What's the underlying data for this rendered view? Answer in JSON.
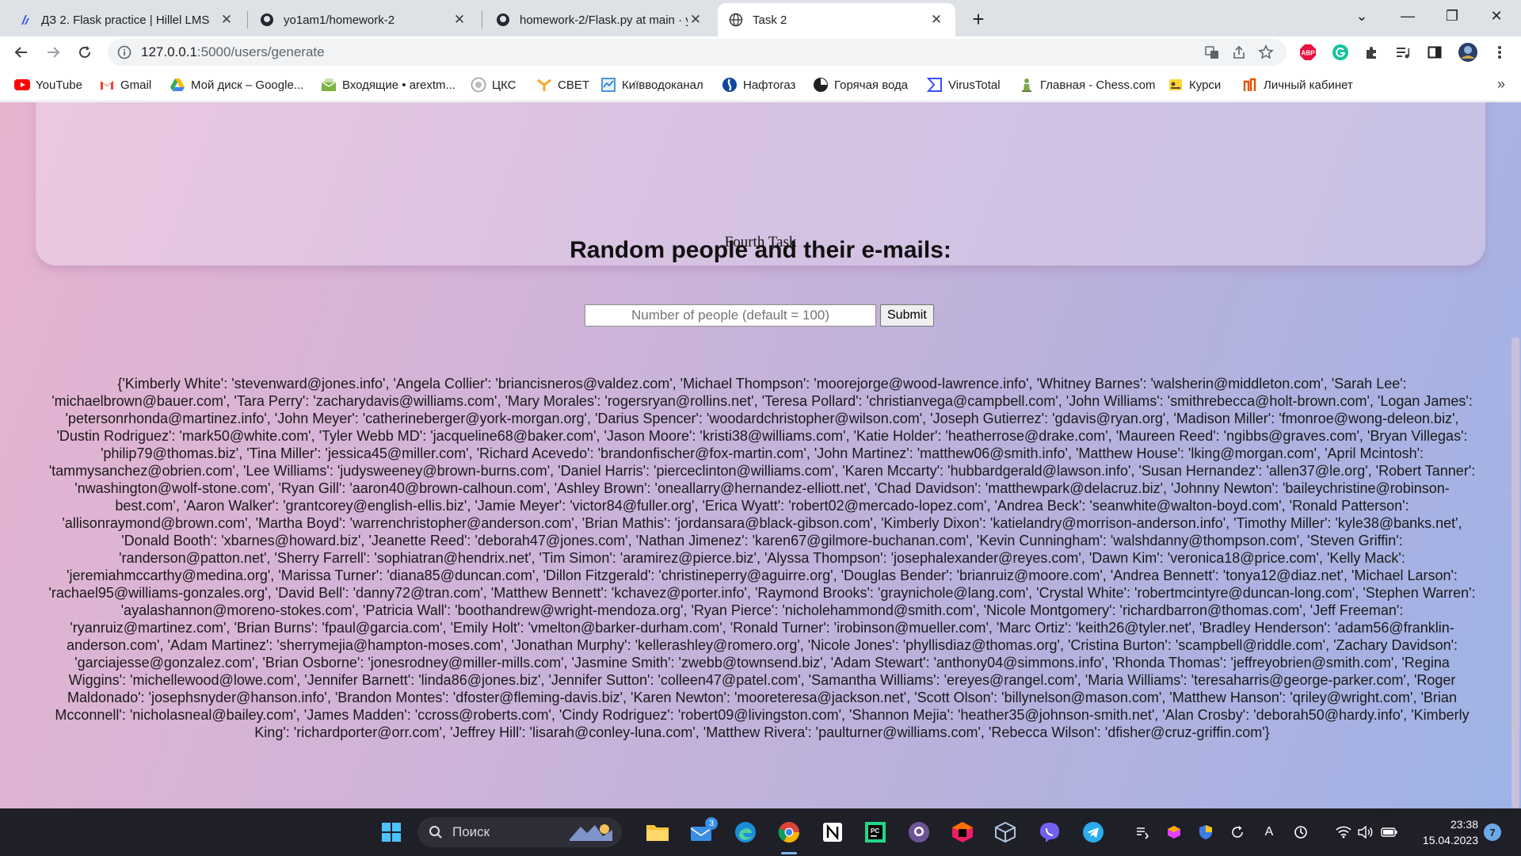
{
  "browser": {
    "tabs": [
      {
        "title": "ДЗ 2. Flask practice | Hillel LMS",
        "icon": "hillel-icon"
      },
      {
        "title": "yo1am1/homework-2",
        "icon": "github-icon"
      },
      {
        "title": "homework-2/Flask.py at main · yo",
        "icon": "github-icon"
      },
      {
        "title": "Task 2",
        "icon": "globe-icon"
      }
    ],
    "address": {
      "host": "127.0.0.1",
      "path": ":5000/users/generate"
    },
    "bookmarks": [
      {
        "label": "YouTube",
        "icon": "youtube-icon"
      },
      {
        "label": "Gmail",
        "icon": "gmail-icon"
      },
      {
        "label": "Мой диск – Google...",
        "icon": "google-drive-icon"
      },
      {
        "label": "Входящие • arextm...",
        "icon": "mail-icon"
      },
      {
        "label": "ЦКС",
        "icon": "cks-icon"
      },
      {
        "label": "СВЕТ",
        "icon": "svet-icon"
      },
      {
        "label": "Київводоканал",
        "icon": "vodokanal-icon"
      },
      {
        "label": "Нафтогаз",
        "icon": "naftogaz-icon"
      },
      {
        "label": "Горячая вода",
        "icon": "hot-water-icon"
      },
      {
        "label": "VirusTotal",
        "icon": "virustotal-icon"
      },
      {
        "label": "Главная - Chess.com",
        "icon": "chess-icon"
      },
      {
        "label": "Курси",
        "icon": "courses-icon"
      },
      {
        "label": "Личный кабинет",
        "icon": "cabinet-icon"
      }
    ],
    "extensions": {
      "abp": "ABP"
    }
  },
  "page": {
    "nav_link": "Fourth Task",
    "heading": "Random people and their e-mails:",
    "input_placeholder": "Number of people (default = 100)",
    "submit_label": "Submit",
    "result": "{'Kimberly White': 'stevenward@jones.info', 'Angela Collier': 'briancisneros@valdez.com', 'Michael Thompson': 'moorejorge@wood-lawrence.info', 'Whitney Barnes': 'walsherin@middleton.com', 'Sarah Lee': 'michaelbrown@bauer.com', 'Tara Perry': 'zacharydavis@williams.com', 'Mary Morales': 'rogersryan@rollins.net', 'Teresa Pollard': 'christianvega@campbell.com', 'John Williams': 'smithrebecca@holt-brown.com', 'Logan James': 'petersonrhonda@martinez.info', 'John Meyer': 'catherineberger@york-morgan.org', 'Darius Spencer': 'woodardchristopher@wilson.com', 'Joseph Gutierrez': 'gdavis@ryan.org', 'Madison Miller': 'fmonroe@wong-deleon.biz', 'Dustin Rodriguez': 'mark50@white.com', 'Tyler Webb MD': 'jacqueline68@baker.com', 'Jason Moore': 'kristi38@williams.com', 'Katie Holder': 'heatherrose@drake.com', 'Maureen Reed': 'ngibbs@graves.com', 'Bryan Villegas': 'philip79@thomas.biz', 'Tina Miller': 'jessica45@miller.com', 'Richard Acevedo': 'brandonfischer@fox-martin.com', 'John Martinez': 'matthew06@smith.info', 'Matthew House': 'lking@morgan.com', 'April Mcintosh': 'tammysanchez@obrien.com', 'Lee Williams': 'judysweeney@brown-burns.com', 'Daniel Harris': 'pierceclinton@williams.com', 'Karen Mccarty': 'hubbardgerald@lawson.info', 'Susan Hernandez': 'allen37@le.org', 'Robert Tanner': 'nwashington@wolf-stone.com', 'Ryan Gill': 'aaron40@brown-calhoun.com', 'Ashley Brown': 'oneallarry@hernandez-elliott.net', 'Chad Davidson': 'matthewpark@delacruz.biz', 'Johnny Newton': 'baileychristine@robinson-best.com', 'Aaron Walker': 'grantcorey@english-ellis.biz', 'Jamie Meyer': 'victor84@fuller.org', 'Erica Wyatt': 'robert02@mercado-lopez.com', 'Andrea Beck': 'seanwhite@walton-boyd.com', 'Ronald Patterson': 'allisonraymond@brown.com', 'Martha Boyd': 'warrenchristopher@anderson.com', 'Brian Mathis': 'jordansara@black-gibson.com', 'Kimberly Dixon': 'katielandry@morrison-anderson.info', 'Timothy Miller': 'kyle38@banks.net', 'Donald Booth': 'xbarnes@howard.biz', 'Jeanette Reed': 'deborah47@jones.com', 'Nathan Jimenez': 'karen67@gilmore-buchanan.com', 'Kevin Cunningham': 'walshdanny@thompson.com', 'Steven Griffin': 'randerson@patton.net', 'Sherry Farrell': 'sophiatran@hendrix.net', 'Tim Simon': 'aramirez@pierce.biz', 'Alyssa Thompson': 'josephalexander@reyes.com', 'Dawn Kim': 'veronica18@price.com', 'Kelly Mack': 'jeremiahmccarthy@medina.org', 'Marissa Turner': 'diana85@duncan.com', 'Dillon Fitzgerald': 'christineperry@aguirre.org', 'Douglas Bender': 'brianruiz@moore.com', 'Andrea Bennett': 'tonya12@diaz.net', 'Michael Larson': 'rachael95@williams-gonzales.org', 'David Bell': 'danny72@tran.com', 'Matthew Bennett': 'kchavez@porter.info', 'Raymond Brooks': 'graynichole@lang.com', 'Crystal White': 'robertmcintyre@duncan-long.com', 'Stephen Warren': 'ayalashannon@moreno-stokes.com', 'Patricia Wall': 'boothandrew@wright-mendoza.org', 'Ryan Pierce': 'nicholehammond@smith.com', 'Nicole Montgomery': 'richardbarron@thomas.com', 'Jeff Freeman': 'ryanruiz@martinez.com', 'Brian Burns': 'fpaul@garcia.com', 'Emily Holt': 'vmelton@barker-durham.com', 'Ronald Turner': 'irobinson@mueller.com', 'Marc Ortiz': 'keith26@tyler.net', 'Bradley Henderson': 'adam56@franklin-anderson.com', 'Adam Martinez': 'sherrymejia@hampton-moses.com', 'Jonathan Murphy': 'kellerashley@romero.org', 'Nicole Jones': 'phyllisdiaz@thomas.org', 'Cristina Burton': 'scampbell@riddle.com', 'Zachary Davidson': 'garciajesse@gonzalez.com', 'Brian Osborne': 'jonesrodney@miller-mills.com', 'Jasmine Smith': 'zwebb@townsend.biz', 'Adam Stewart': 'anthony04@simmons.info', 'Rhonda Thomas': 'jeffreyobrien@smith.com', 'Regina Wiggins': 'michellewood@lowe.com', 'Jennifer Barnett': 'linda86@jones.biz', 'Jennifer Sutton': 'colleen47@patel.com', 'Samantha Williams': 'ereyes@rangel.com', 'Maria Williams': 'teresaharris@george-parker.com', 'Roger Maldonado': 'josephsnyder@hanson.info', 'Brandon Montes': 'dfoster@fleming-davis.biz', 'Karen Newton': 'mooreteresa@jackson.net', 'Scott Olson': 'billynelson@mason.com', 'Matthew Hanson': 'qriley@wright.com', 'Brian Mcconnell': 'nicholasneal@bailey.com', 'James Madden': 'ccross@roberts.com', 'Cindy Rodriguez': 'robert09@livingston.com', 'Shannon Mejia': 'heather35@johnson-smith.net', 'Alan Crosby': 'deborah50@hardy.info', 'Kimberly King': 'richardporter@orr.com', 'Jeffrey Hill': 'lisarah@conley-luna.com', 'Matthew Rivera': 'paulturner@williams.com', 'Rebecca Wilson': 'dfisher@cruz-griffin.com'}"
  },
  "taskbar": {
    "search_label": "Поиск",
    "mail_badge": "3",
    "time": "23:38",
    "date": "15.04.2023",
    "notification_count": "7",
    "lang_indicator": "A"
  },
  "colors": {
    "page_gradient_start": "#e8b3cf",
    "page_gradient_end": "#9eb3e6",
    "taskbar": "#1f1f28",
    "tabstrip": "#dee1e6"
  }
}
